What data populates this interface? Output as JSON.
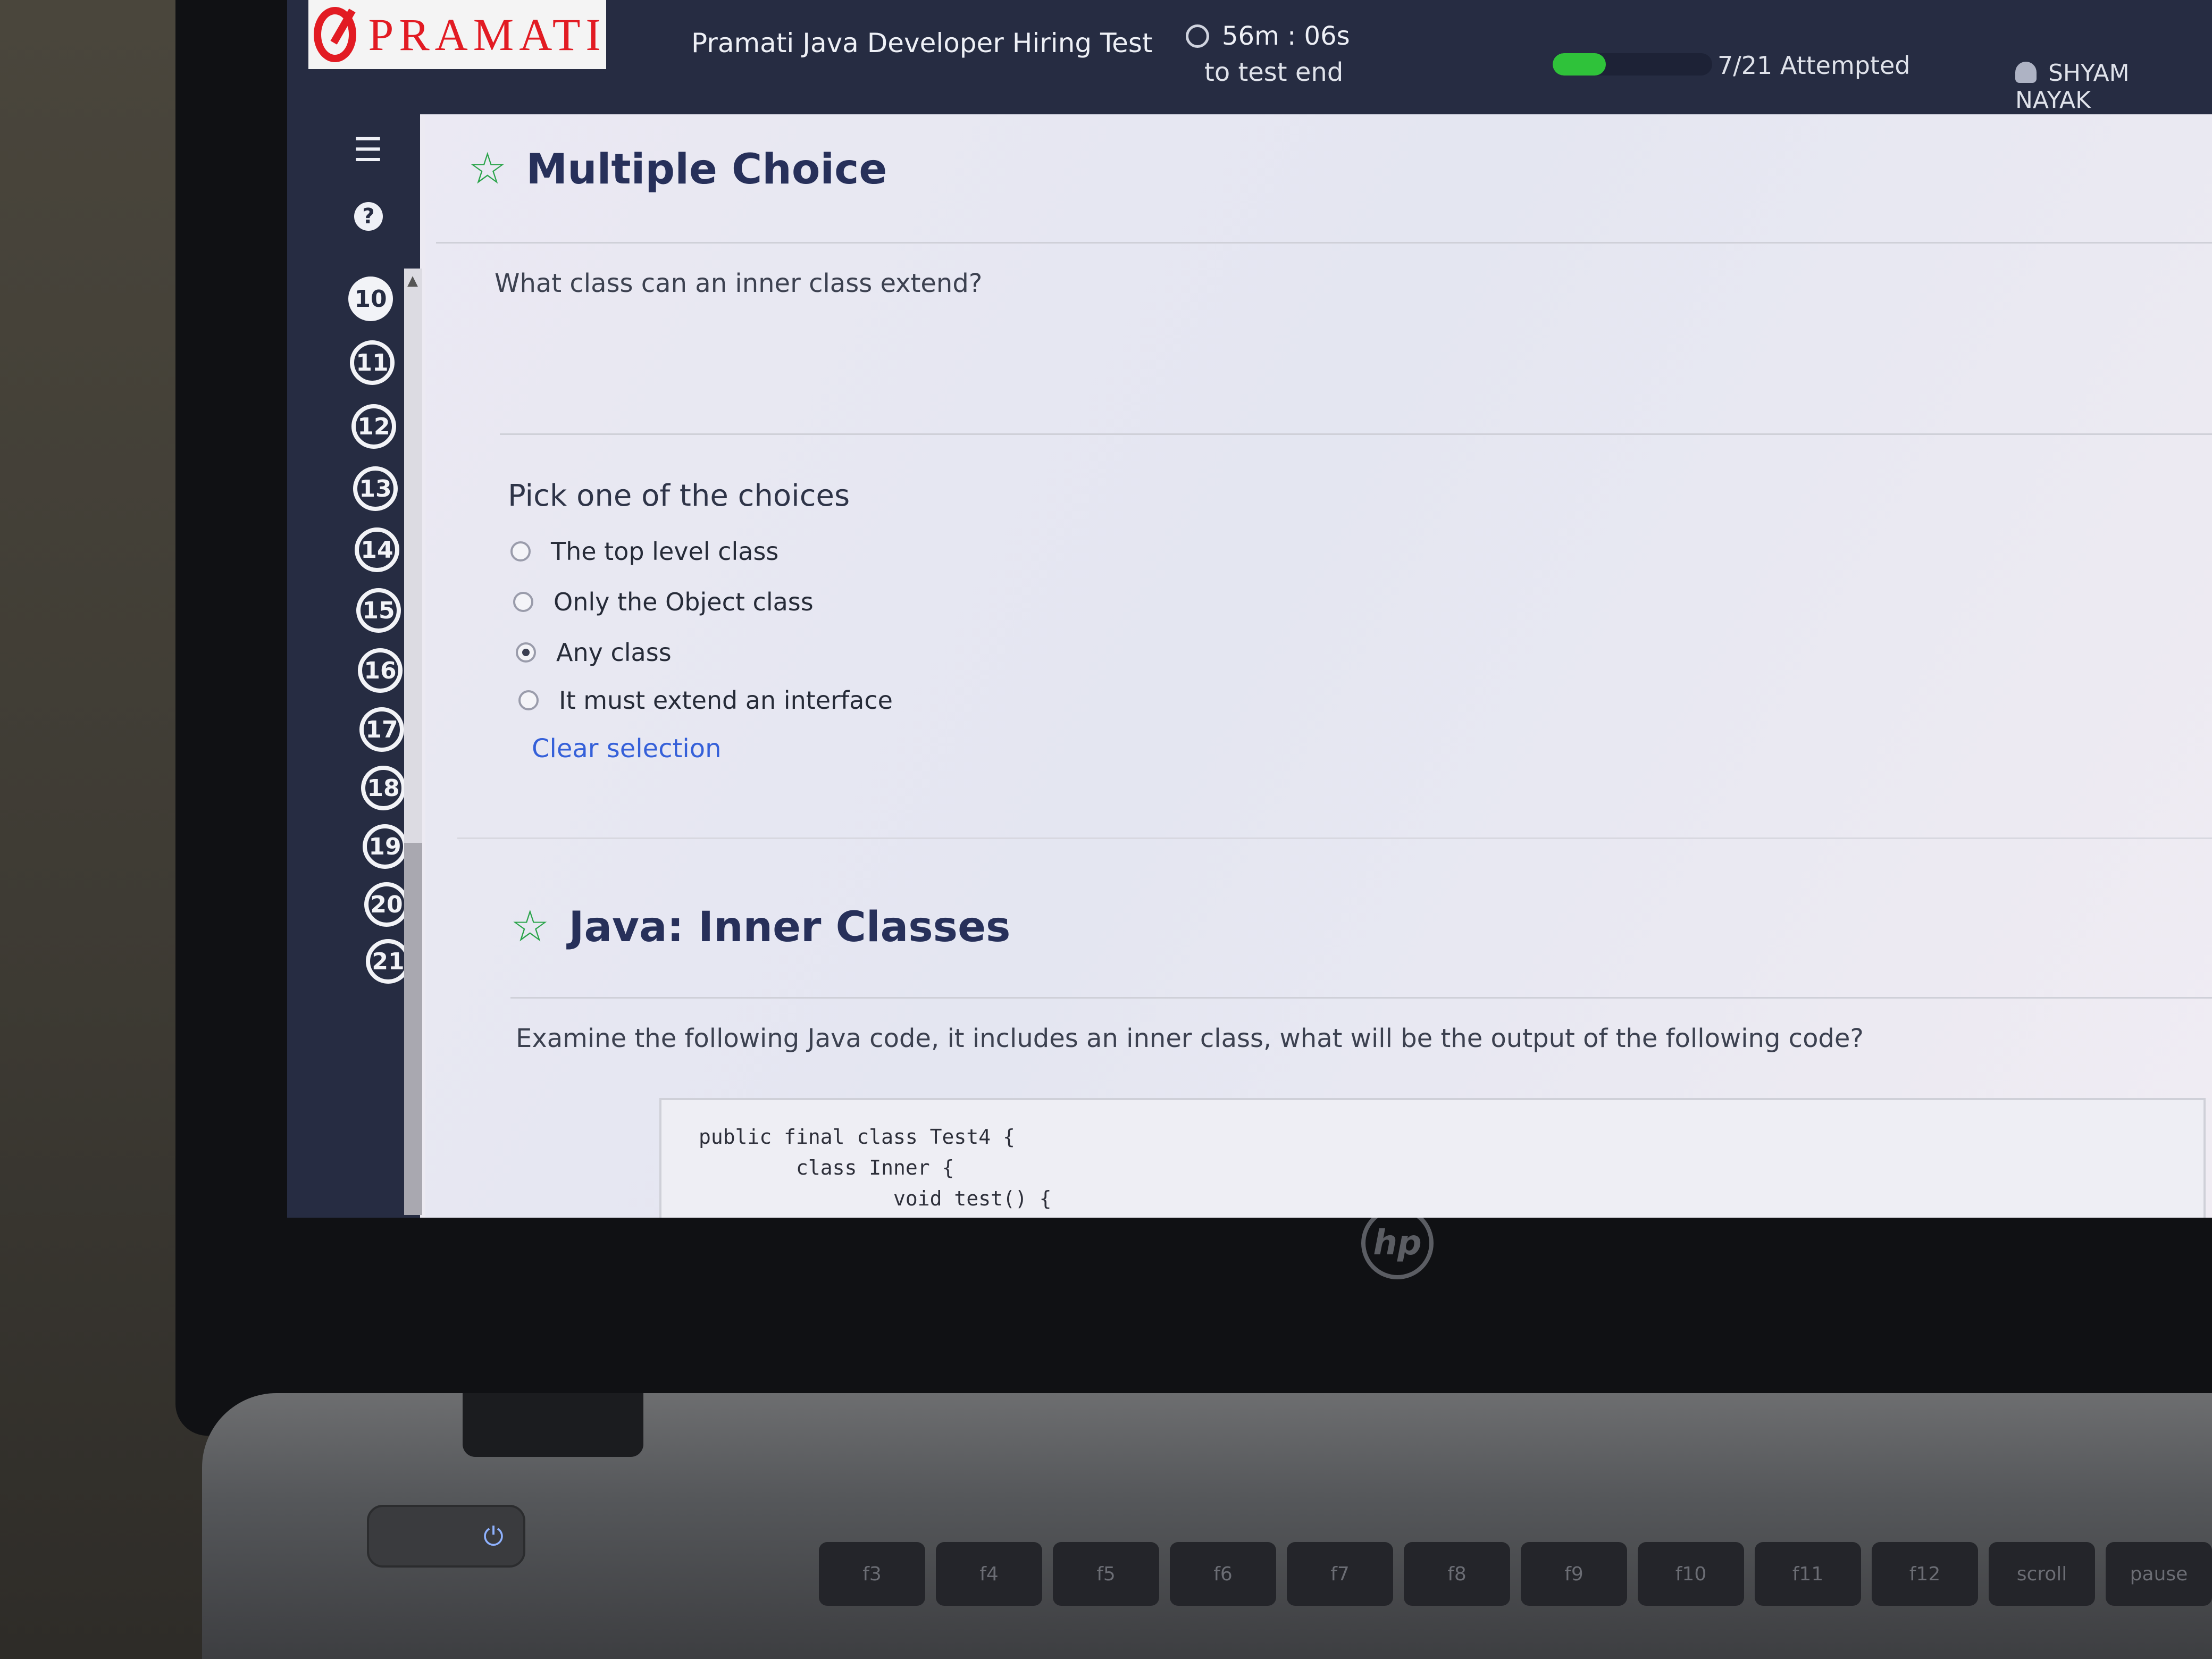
{
  "header": {
    "brand": "PRAMATI",
    "test_title": "Pramati Java Developer Hiring Test",
    "timer": "56m : 06s",
    "timer_sub": "to test end",
    "progress_fraction": 0.333,
    "attempted": "7/21 Attempted",
    "user_name": "SHYAM NAYAK"
  },
  "sidebar": {
    "icons": [
      "list-icon",
      "help-icon"
    ],
    "question_numbers": [
      "10",
      "11",
      "12",
      "13",
      "14",
      "15",
      "16",
      "17",
      "18",
      "19",
      "20",
      "21"
    ],
    "current_question": "10"
  },
  "question1": {
    "type_title": "Multiple Choice",
    "text": "What class can an inner class extend?",
    "pick_label": "Pick one of the choices",
    "choices": [
      "The top level class",
      "Only the Object class",
      "Any class",
      "It must extend an interface"
    ],
    "selected_index": 2,
    "clear_label": "Clear selection"
  },
  "question2": {
    "type_title": "Java: Inner Classes",
    "text": "Examine the following Java code, it includes an inner class, what will be the output of the following code?",
    "code_lines": [
      "public final class Test4 {",
      "        class Inner {",
      "                void test() {"
    ]
  },
  "keyboard": {
    "keys": [
      "f3",
      "f4",
      "f5",
      "f6",
      "f7",
      "f8",
      "f9",
      "f10",
      "f11",
      "f12",
      "scroll",
      "pause"
    ]
  },
  "device": {
    "logo": "hp"
  },
  "colors": {
    "topbar": "#262c42",
    "accent_green": "#2fc23a",
    "star_green": "#2aa44a",
    "link_blue": "#3560d9",
    "brand_red": "#e21b23"
  }
}
